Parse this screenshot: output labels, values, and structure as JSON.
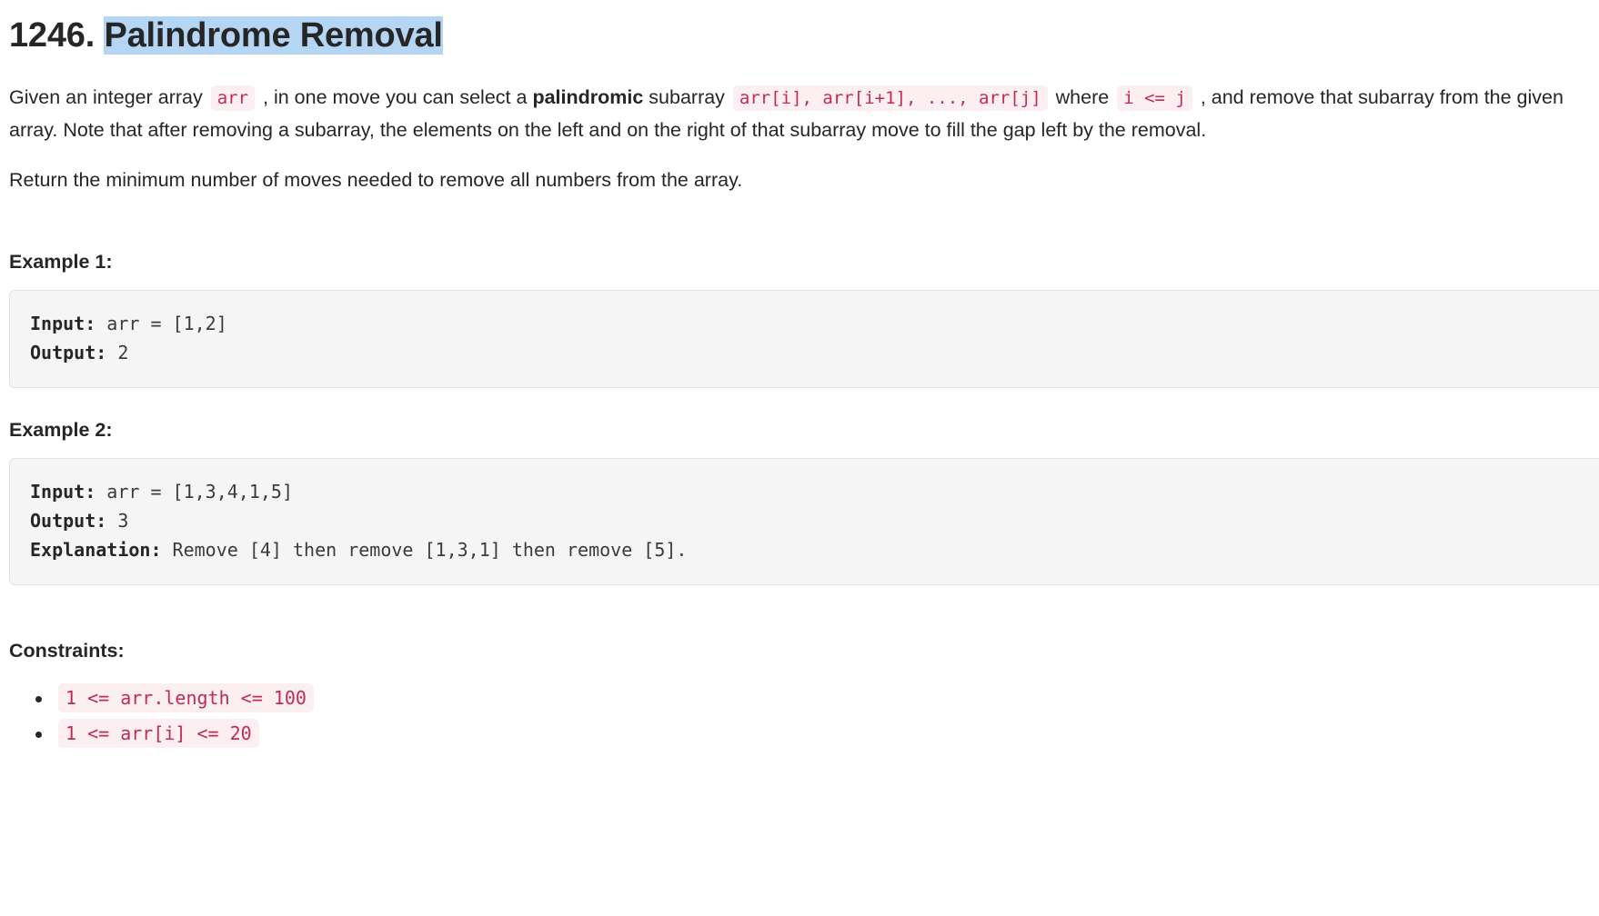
{
  "problem": {
    "number": "1246.",
    "title": "Palindrome Removal",
    "title_selected": true,
    "selection_color": "#b5d5f5"
  },
  "description": {
    "p1_part1": "Given an integer array",
    "p1_code1": "arr",
    "p1_part2": ", in one move you can select a",
    "p1_bold": "palindromic",
    "p1_part3": "subarray",
    "p1_code2": "arr[i], arr[i+1], ..., arr[j]",
    "p1_part4": "where",
    "p1_code3": "i <= j",
    "p1_part5": ", and remove that subarray from the given array. Note that after removing a subarray, the elements on the left and on the right of that subarray move to fill the gap left by the removal.",
    "p2": "Return the minimum number of moves needed to remove all numbers from the array."
  },
  "examples": [
    {
      "heading": "Example 1:",
      "lines": [
        {
          "label": "Input:",
          "value": " arr = [1,2]"
        },
        {
          "label": "Output:",
          "value": " 2"
        }
      ]
    },
    {
      "heading": "Example 2:",
      "lines": [
        {
          "label": "Input:",
          "value": " arr = [1,3,4,1,5]"
        },
        {
          "label": "Output:",
          "value": " 3"
        },
        {
          "label": "Explanation:",
          "value": " Remove [4] then remove [1,3,1] then remove [5]."
        }
      ]
    }
  ],
  "constraints": {
    "heading": "Constraints:",
    "items": [
      "1 <= arr.length <= 100",
      "1 <= arr[i] <= 20"
    ]
  },
  "colors": {
    "code_text": "#c02c54",
    "code_bg": "#fbeff2",
    "block_bg": "#f5f5f5",
    "block_border": "#e3e3e3",
    "text": "#262626"
  }
}
